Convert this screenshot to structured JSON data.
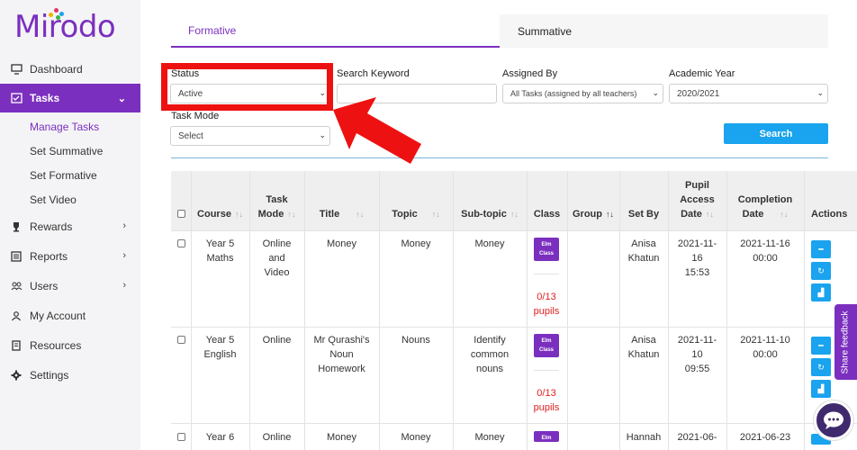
{
  "brand": {
    "name": "Mirodo"
  },
  "sidebar": {
    "items": [
      {
        "label": "Dashboard"
      },
      {
        "label": "Tasks",
        "sub": [
          "Manage Tasks",
          "Set Summative",
          "Set Formative",
          "Set Video"
        ]
      },
      {
        "label": "Rewards"
      },
      {
        "label": "Reports"
      },
      {
        "label": "Users"
      },
      {
        "label": "My Account"
      },
      {
        "label": "Resources"
      },
      {
        "label": "Settings"
      }
    ]
  },
  "tabs": [
    "Formative",
    "Summative"
  ],
  "filters": {
    "status": {
      "label": "Status",
      "value": "Active"
    },
    "keyword": {
      "label": "Search Keyword",
      "value": ""
    },
    "assigned_by": {
      "label": "Assigned By",
      "value": "All Tasks (assigned by all teachers)"
    },
    "academic_year": {
      "label": "Academic Year",
      "value": "2020/2021"
    },
    "task_mode": {
      "label": "Task Mode",
      "value": "Select"
    },
    "search_label": "Search"
  },
  "table": {
    "headers": {
      "course": "Course",
      "task_mode": [
        "Task",
        "Mode"
      ],
      "title": "Title",
      "topic": "Topic",
      "subtopic": "Sub-topic",
      "class": "Class",
      "group": "Group",
      "set_by": "Set By",
      "pupil_access": [
        "Pupil",
        "Access",
        "Date"
      ],
      "completion": [
        "Completion",
        "Date"
      ],
      "actions": "Actions"
    },
    "rows": [
      {
        "course": [
          "Year 5",
          "Maths"
        ],
        "task_mode": [
          "Online",
          "and",
          "Video"
        ],
        "title": [
          "Money"
        ],
        "topic": "Money",
        "subtopic": [
          "Money"
        ],
        "class_badge": [
          "Elm",
          "Class"
        ],
        "pupils": [
          "0/13",
          "pupils"
        ],
        "set_by": [
          "Anisa",
          "Khatun"
        ],
        "pupil_access": [
          "2021-11-",
          "16",
          "15:53"
        ],
        "completion": [
          "2021-11-16",
          "00:00"
        ]
      },
      {
        "course": [
          "Year 5",
          "English"
        ],
        "task_mode": [
          "Online"
        ],
        "title": [
          "Mr Qurashi's",
          "Noun",
          "Homework"
        ],
        "topic": "Nouns",
        "subtopic": [
          "Identify",
          "common",
          "nouns"
        ],
        "class_badge": [
          "Elm",
          "Class"
        ],
        "pupils": [
          "0/13",
          "pupils"
        ],
        "set_by": [
          "Anisa",
          "Khatun"
        ],
        "pupil_access": [
          "2021-11-",
          "10",
          "09:55"
        ],
        "completion": [
          "2021-11-10",
          "00:00"
        ]
      },
      {
        "course": [
          "Year 6"
        ],
        "task_mode": [
          "Online"
        ],
        "title": [
          "Money"
        ],
        "topic": "Money",
        "subtopic": [
          "Money"
        ],
        "class_badge": [
          "Elm"
        ],
        "set_by": [
          "Hannah"
        ],
        "pupil_access": [
          "2021-06-"
        ],
        "completion": [
          "2021-06-23"
        ]
      }
    ]
  },
  "widgets": {
    "feedback_label": "Share feedback"
  },
  "colors": {
    "brand": "#7b2fbf",
    "accent": "#1aa3ee",
    "alert": "#ee1111"
  }
}
